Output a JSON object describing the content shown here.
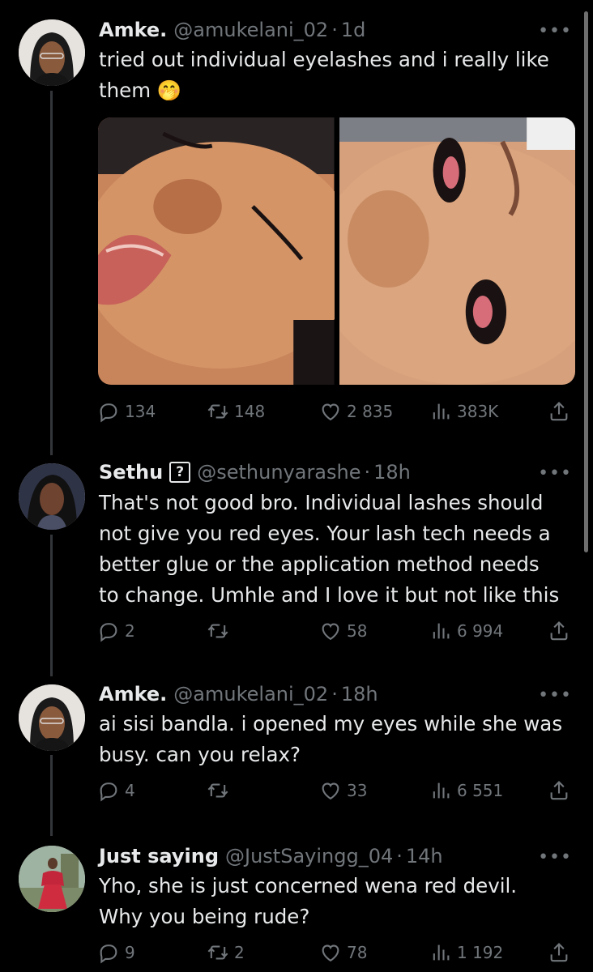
{
  "colors": {
    "background": "#000000",
    "text": "#e7e9ea",
    "muted": "#71767b",
    "thread": "#333639"
  },
  "tweets": [
    {
      "name": "Amke.",
      "handle": "@amukelani_02",
      "time": "1d",
      "text": "tried out individual eyelashes and i really like them 🤭",
      "media_alt": [
        "close-up face eyes closed",
        "close-up face with lashes"
      ],
      "stats": {
        "replies": "134",
        "retweets": "148",
        "likes": "2 835",
        "views": "383K"
      },
      "more": "•••"
    },
    {
      "name": "Sethu",
      "badge": "?",
      "handle": "@sethunyarashe",
      "time": "18h",
      "text": "That's not good bro. Individual lashes should not give you red eyes. Your lash tech needs a better glue or the application method needs to change. Umhle and I love it but not like this",
      "stats": {
        "replies": "2",
        "retweets": "",
        "likes": "58",
        "views": "6 994"
      },
      "more": "•••"
    },
    {
      "name": "Amke.",
      "handle": "@amukelani_02",
      "time": "18h",
      "text": "ai sisi bandla. i opened my eyes while she was busy. can you relax?",
      "stats": {
        "replies": "4",
        "retweets": "",
        "likes": "33",
        "views": "6 551"
      },
      "more": "•••"
    },
    {
      "name": "Just saying",
      "handle": "@JustSayingg_04",
      "time": "14h",
      "text": "Yho, she is just concerned wena red devil. Why you being rude?",
      "stats": {
        "replies": "9",
        "retweets": "2",
        "likes": "78",
        "views": "1 192"
      },
      "more": "•••"
    }
  ],
  "icons": [
    "reply-icon",
    "retweet-icon",
    "like-icon",
    "views-icon",
    "share-icon",
    "more-icon"
  ]
}
